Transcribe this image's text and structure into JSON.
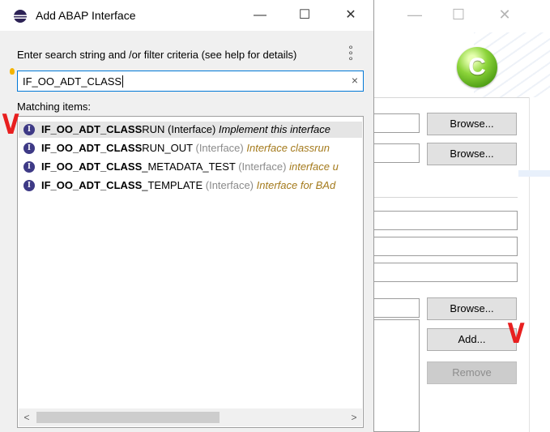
{
  "background": {
    "logo_letter": "C",
    "buttons": {
      "browse1": "Browse...",
      "browse2": "Browse...",
      "browse3": "Browse...",
      "add": "Add...",
      "remove": "Remove"
    },
    "annotation_mark": "V"
  },
  "dialog": {
    "title": "Add ABAP Interface",
    "window_buttons": {
      "minimize": "—",
      "maximize": "☐",
      "close": "✕"
    },
    "filter_label": "Enter search string and /or filter criteria (see help for details)",
    "search": {
      "value": "IF_OO_ADT_CLASS",
      "clear_glyph": "×"
    },
    "matching_label": "Matching items:",
    "items": [
      {
        "bold": "IF_OO_ADT_CLASS",
        "rest": "RUN",
        "type": "(Interface)",
        "desc": "Implement this interface",
        "selected": true
      },
      {
        "bold": "IF_OO_ADT_CLASS",
        "rest": "RUN_OUT",
        "type": "(Interface)",
        "desc": "Interface classrun",
        "selected": false
      },
      {
        "bold": "IF_OO_ADT_CLASS",
        "rest": "_METADATA_TEST",
        "type": "(Interface)",
        "desc": "interface u",
        "selected": false
      },
      {
        "bold": "IF_OO_ADT_CLASS",
        "rest": "_TEMPLATE",
        "type": "(Interface)",
        "desc": "Interface for BAd",
        "selected": false
      }
    ],
    "icon_letter": "I",
    "scroll": {
      "left": "<",
      "right": ">"
    },
    "annotation_mark": "V"
  }
}
